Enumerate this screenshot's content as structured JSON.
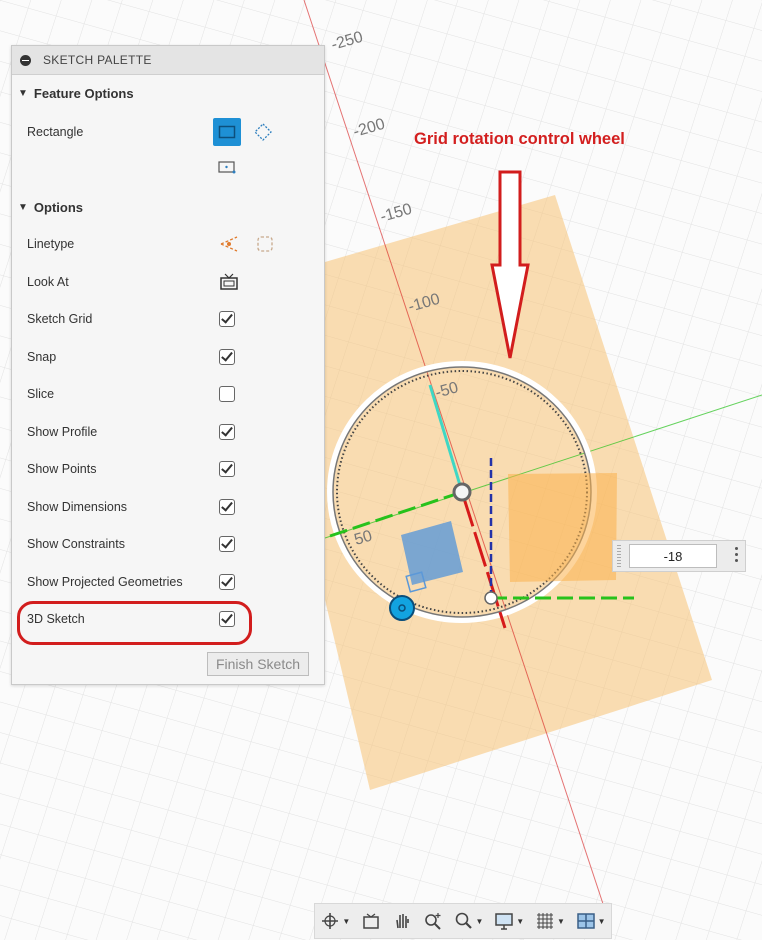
{
  "palette": {
    "title": "SKETCH PALETTE",
    "feature_options": {
      "heading": "Feature Options",
      "rectangle_label": "Rectangle"
    },
    "options": {
      "heading": "Options",
      "rows": [
        {
          "label": "Linetype",
          "control": "icons"
        },
        {
          "label": "Look At",
          "control": "icon"
        },
        {
          "label": "Sketch Grid",
          "checked": true
        },
        {
          "label": "Snap",
          "checked": true
        },
        {
          "label": "Slice",
          "checked": false
        },
        {
          "label": "Show Profile",
          "checked": true
        },
        {
          "label": "Show Points",
          "checked": true
        },
        {
          "label": "Show Dimensions",
          "checked": true
        },
        {
          "label": "Show Constraints",
          "checked": true
        },
        {
          "label": "Show Projected Geometries",
          "checked": true
        },
        {
          "label": "3D Sketch",
          "checked": true
        }
      ]
    },
    "finish_button": "Finish Sketch"
  },
  "annotation": {
    "callout_text": "Grid rotation control wheel",
    "callout_color": "#d31f1f"
  },
  "canvas": {
    "ruler_labels": [
      "-250",
      "-200",
      "-150",
      "-100",
      "-50",
      "50"
    ],
    "accent_orange": "#f7c275",
    "axis_red": "#d61a1a",
    "axis_green": "#27c21c",
    "axis_cyan": "#3fd7c4",
    "sketch_blue": "#5b98d8"
  },
  "dimension_input": {
    "value": "-18"
  },
  "nav_toolbar": {
    "icons": [
      "orbit-icon",
      "look-at-icon",
      "pan-icon",
      "zoom-window-icon",
      "zoom-icon",
      "display-settings-icon",
      "grid-settings-icon",
      "viewports-icon"
    ]
  }
}
